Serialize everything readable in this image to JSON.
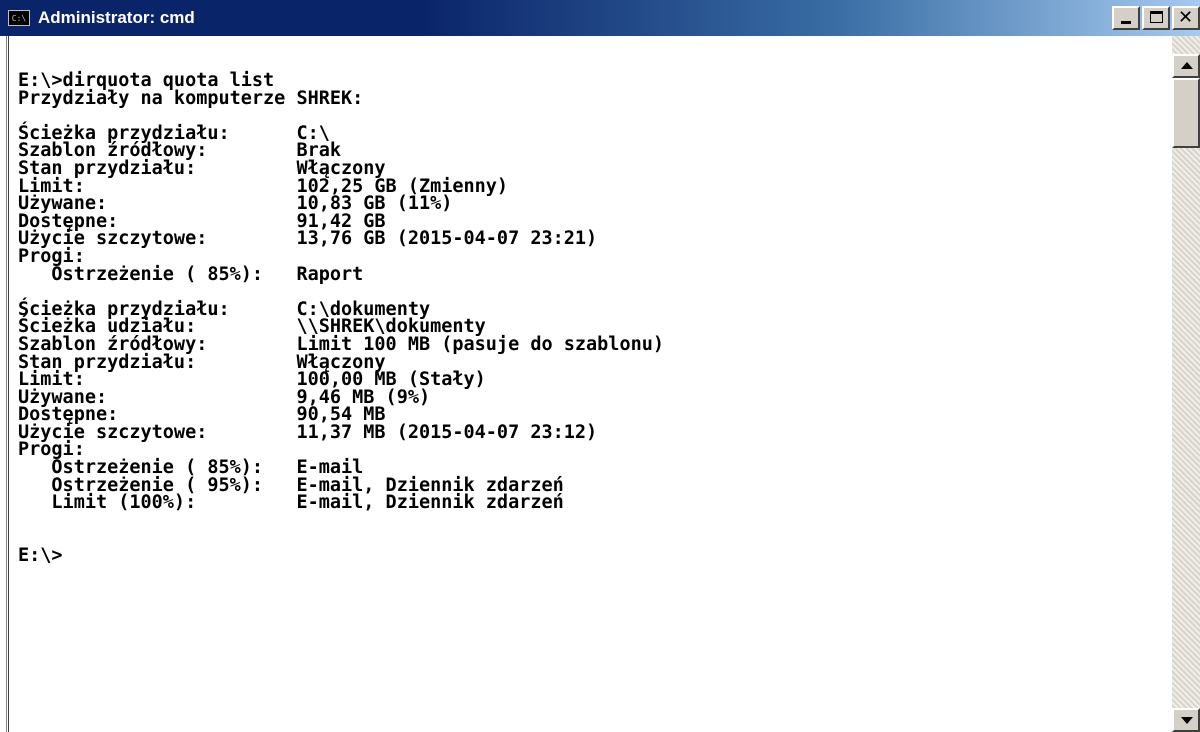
{
  "window": {
    "title": "Administrator: cmd",
    "icon": "console-icon",
    "icon_text": "C:\\",
    "controls": [
      "minimize-icon",
      "maximize-icon",
      "close-icon"
    ],
    "close_glyph": "✕"
  },
  "console": {
    "lines": [
      "E:\\>dirquota quota list",
      "Przydziały na komputerze SHREK:",
      "",
      "Ścieżka przydziału:      C:\\",
      "Szablon źródłowy:        Brak",
      "Stan przydziału:         Włączony",
      "Limit:                   102,25 GB (Zmienny)",
      "Używane:                 10,83 GB (11%)",
      "Dostępne:                91,42 GB",
      "Użycie szczytowe:        13,76 GB (2015-04-07 23:21)",
      "Progi:",
      "   Ostrzeżenie ( 85%):   Raport",
      "",
      "Ścieżka przydziału:      C:\\dokumenty",
      "Ścieżka udziału:         \\\\SHREK\\dokumenty",
      "Szablon źródłowy:        Limit 100 MB (pasuje do szablonu)",
      "Stan przydziału:         Włączony",
      "Limit:                   100,00 MB (Stały)",
      "Używane:                 9,46 MB (9%)",
      "Dostępne:                90,54 MB",
      "Użycie szczytowe:        11,37 MB (2015-04-07 23:12)",
      "Progi:",
      "   Ostrzeżenie ( 85%):   E-mail",
      "   Ostrzeżenie ( 95%):   E-mail, Dziennik zdarzeń",
      "   Limit (100%):         E-mail, Dziennik zdarzeń",
      "",
      "",
      "E:\\>"
    ]
  },
  "colors": {
    "titlebar": "#0a246a",
    "console_bg": "#ffffff",
    "console_fg": "#000000"
  }
}
